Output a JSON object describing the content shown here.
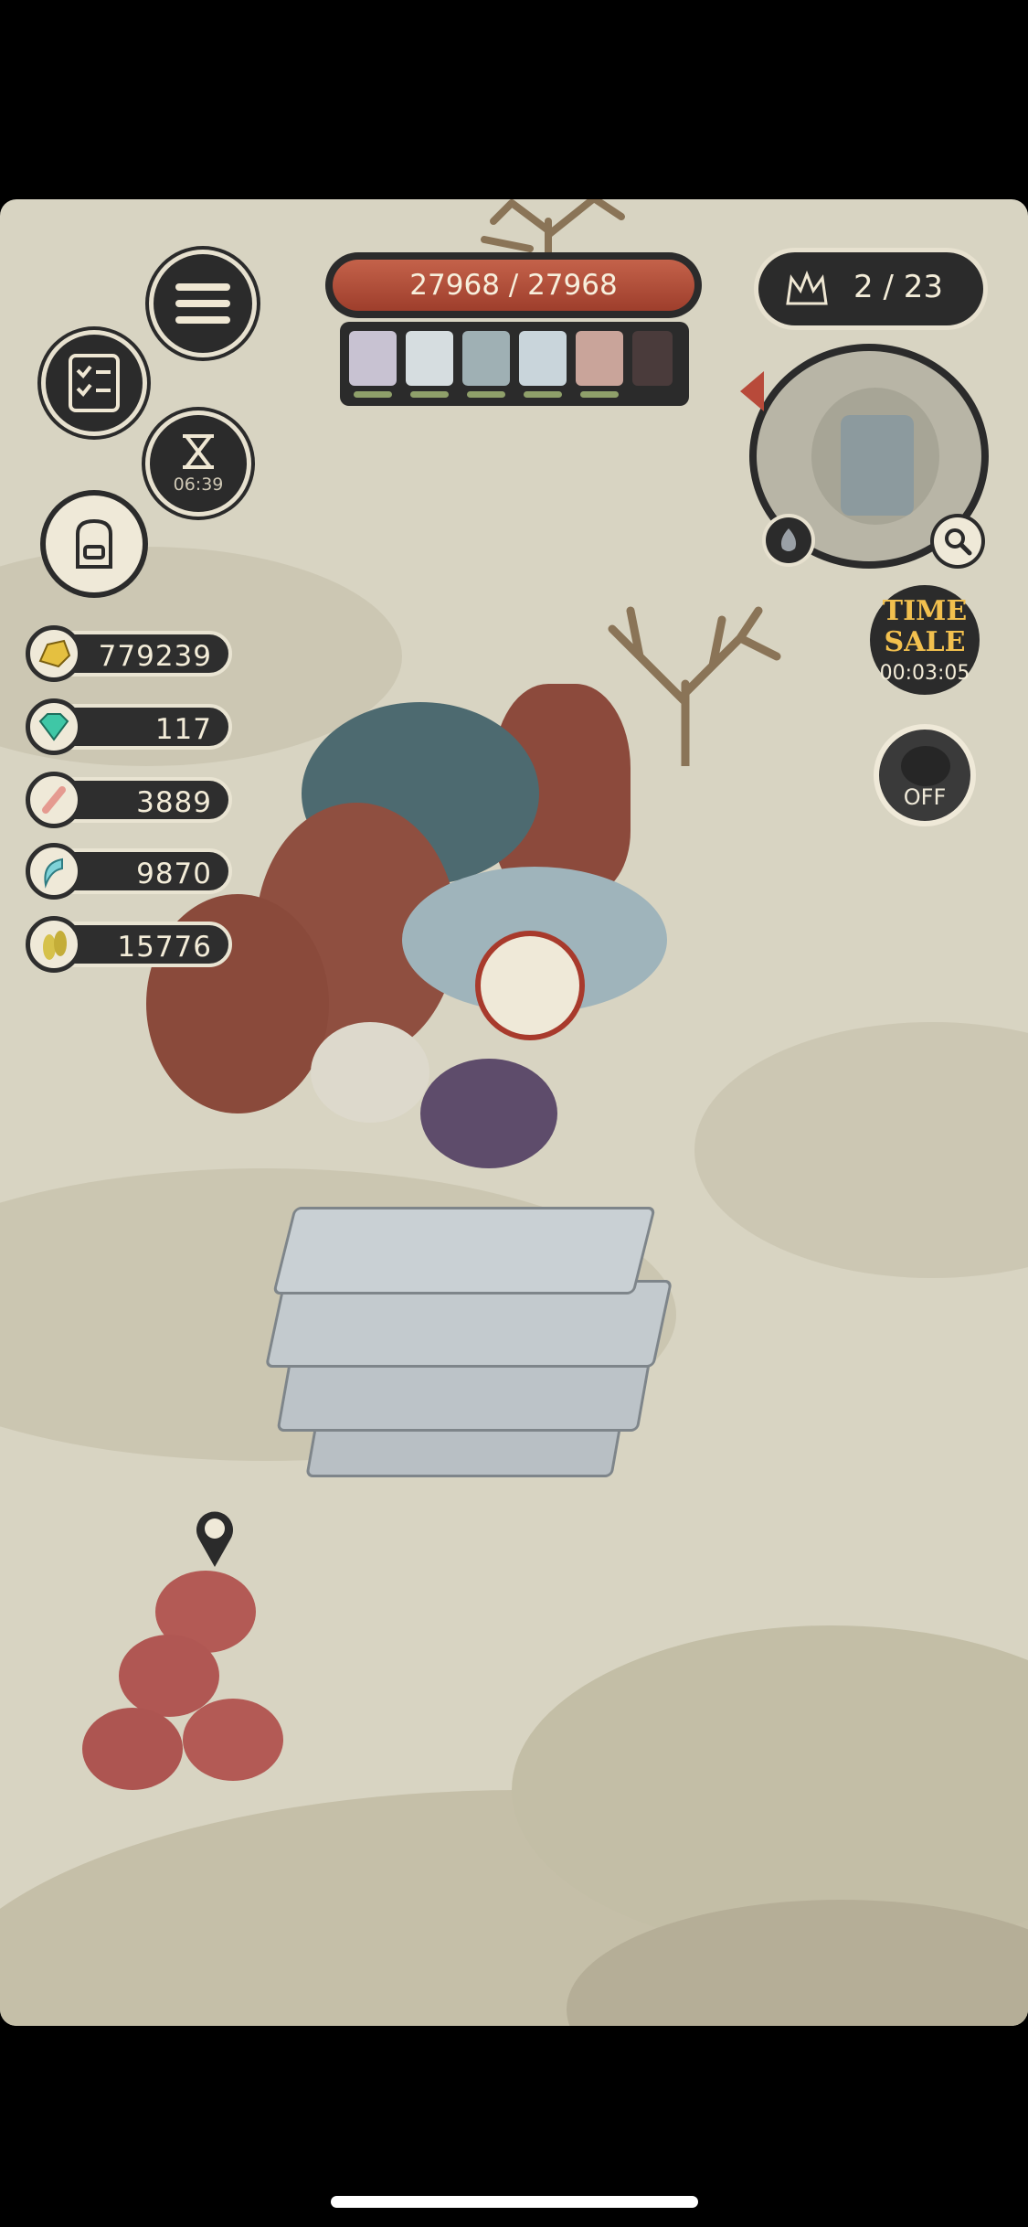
{
  "boss_hp": {
    "text": "27968 / 27968",
    "current": 27968,
    "max": 27968
  },
  "wave": {
    "text": "2 / 23",
    "current": 2,
    "total": 23
  },
  "menu_timer": "06:39",
  "resources": [
    {
      "name": "gold",
      "icon": "gold-nugget-icon",
      "value": "779239",
      "color": "#e5c040"
    },
    {
      "name": "gem",
      "icon": "gem-icon",
      "value": "117",
      "color": "#3fc7a6"
    },
    {
      "name": "bone",
      "icon": "bone-icon",
      "value": "3889",
      "color": "#e59a90"
    },
    {
      "name": "fang",
      "icon": "fang-icon",
      "value": "9870",
      "color": "#7fd2d8"
    },
    {
      "name": "scale",
      "icon": "scale-icon",
      "value": "15776",
      "color": "#d6c14a"
    }
  ],
  "time_sale": {
    "line1": "TIME",
    "line2": "SALE",
    "countdown": "00:03:05"
  },
  "auto_toggle": "OFF",
  "party_slots": [
    "walrus-portrait",
    "ice-drake-portrait",
    "tyrant-portrait",
    "serpent-portrait",
    "blood-dragon-portrait",
    "locked-slot"
  ]
}
